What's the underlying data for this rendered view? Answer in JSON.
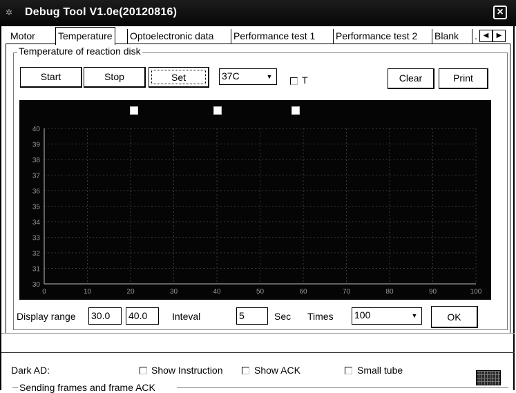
{
  "window": {
    "title": "Debug Tool V1.0e(20120816)",
    "close_glyph": "×"
  },
  "tabs": [
    {
      "label": "Motor"
    },
    {
      "label": "Temperature"
    },
    {
      "label": "Optoelectronic data"
    },
    {
      "label": "Performance test 1"
    },
    {
      "label": "Performance test 2"
    },
    {
      "label": "Blank"
    },
    {
      "label": "."
    }
  ],
  "active_tab": "Temperature",
  "tab_scroll": {
    "left_glyph": "◀",
    "right_glyph": "▶"
  },
  "group": {
    "title": "Temperature of reaction disk",
    "buttons": {
      "start": "Start",
      "stop": "Stop",
      "set": "Set",
      "clear": "Clear",
      "print": "Print"
    },
    "temp_select": {
      "value": "37C"
    },
    "t_checkbox": {
      "label": "T",
      "checked": false
    }
  },
  "chart_data": {
    "type": "line",
    "x": {
      "ticks": [
        "0",
        "10",
        "20",
        "30",
        "40",
        "50",
        "60",
        "70",
        "80",
        "90",
        "100"
      ],
      "range": [
        0,
        100
      ]
    },
    "y": {
      "ticks": [
        "30",
        "31",
        "32",
        "33",
        "34",
        "35",
        "36",
        "37",
        "38",
        "39",
        "40"
      ],
      "range": [
        30,
        40
      ]
    },
    "series": [],
    "grid": true,
    "legend_boxes": 3,
    "background": "#050505",
    "axis_color": "#bfbfbf"
  },
  "controls": {
    "display_range_label": "Display range",
    "range_min": "30.0",
    "range_max": "40.0",
    "interval_label": "Inteval",
    "interval_value": "5",
    "sec_label": "Sec",
    "times_label": "Times",
    "times_value": "100",
    "ok_label": "OK"
  },
  "bottom": {
    "dark_ad_label": "Dark AD:",
    "show_instruction": "Show Instruction",
    "show_ack": "Show ACK",
    "small_tube": "Small tube",
    "sending_frames": "Sending frames and frame ACK"
  },
  "icons": {
    "app": "app-icon",
    "dropdown": "chevron-down-icon",
    "keyboard": "keyboard-icon"
  }
}
